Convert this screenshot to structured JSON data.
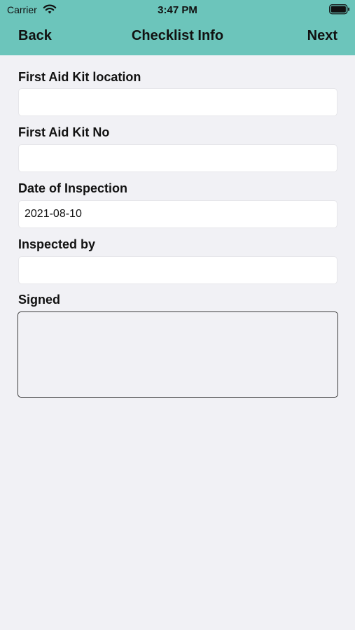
{
  "status_bar": {
    "carrier": "Carrier",
    "time": "3:47 PM",
    "wifi_icon": "wifi-icon",
    "battery_icon": "battery-icon"
  },
  "nav": {
    "back_label": "Back",
    "title": "Checklist Info",
    "next_label": "Next",
    "bar_color": "#6cc5bb"
  },
  "form": {
    "location": {
      "label": "First Aid Kit location",
      "value": ""
    },
    "kit_no": {
      "label": "First Aid Kit No",
      "value": ""
    },
    "date": {
      "label": "Date of Inspection",
      "value": "2021-08-10"
    },
    "inspected_by": {
      "label": "Inspected by",
      "value": ""
    },
    "signed": {
      "label": "Signed"
    }
  },
  "colors": {
    "background": "#f1f1f5",
    "field_background": "#ffffff"
  }
}
